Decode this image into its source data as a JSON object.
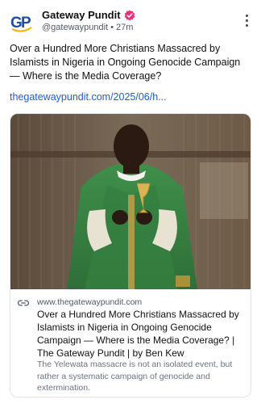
{
  "post": {
    "author_name": "Gateway Pundit",
    "handle": "@gatewaypundit",
    "separator": "•",
    "time_ago": "27m",
    "avatar_text": "GP",
    "text": "Over a Hundred More Christians Massacred by Islamists in Nigeria in Ongoing Genocide Campaign — Where is the Media Coverage?",
    "link_text": "thegatewaypundit.com/2025/06/h..."
  },
  "card": {
    "domain": "www.thegatewaypundit.com",
    "title": "Over a Hundred More Christians Massacred by Islamists in Nigeria in Ongoing Genocide Campaign — Where is the Media Coverage? | The Gateway Pundit | by Ben Kew",
    "description": "The Yelewata massacre is not an isolated event, but rather a systematic campaign of genocide and extermination."
  },
  "icons": {
    "verified": "verified-badge-icon",
    "more": "more-options-icon",
    "link": "link-icon"
  },
  "colors": {
    "link": "#1a5fd1",
    "verified": "#e8327a",
    "avatar_blue": "#1d4ea8",
    "avatar_gold": "#f2b705"
  }
}
